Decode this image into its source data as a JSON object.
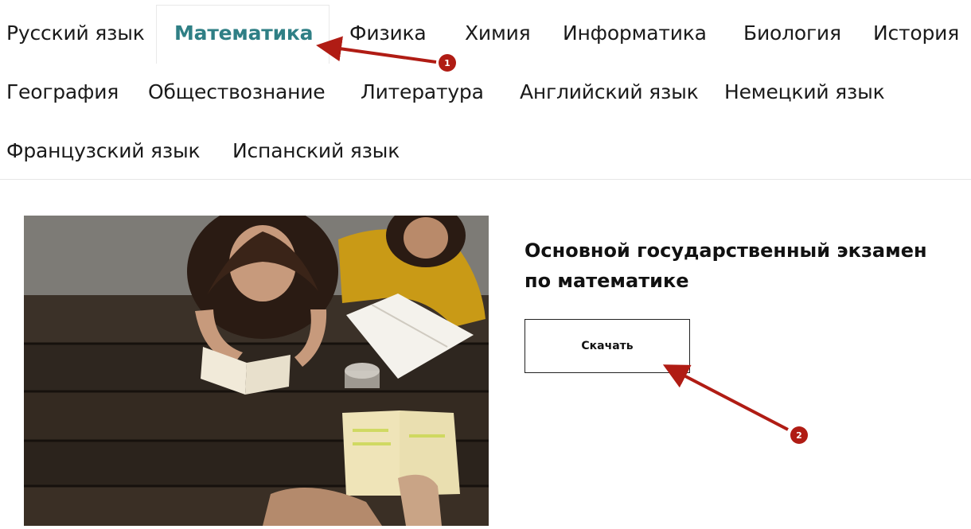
{
  "subjects": {
    "row1": [
      "Русский язык",
      "Математика",
      "Физика",
      "Химия",
      "Информатика",
      "Биология",
      "История"
    ],
    "row2": [
      "География",
      "Обществознание",
      "Литература",
      "Английский язык",
      "Немецкий язык"
    ],
    "row3": [
      "Французский язык",
      "Испанский язык"
    ],
    "active": "Математика"
  },
  "content": {
    "title_line1": "Основной государственный экзамен",
    "title_line2": "по математике",
    "download_label": "Скачать"
  },
  "annotations": {
    "badge1": "1",
    "badge2": "2",
    "color": "#b01c14"
  },
  "colors": {
    "active_tab": "#2f7f85",
    "text": "#1a1a1a"
  },
  "image": {
    "subject": "students-reading-at-wooden-table"
  }
}
